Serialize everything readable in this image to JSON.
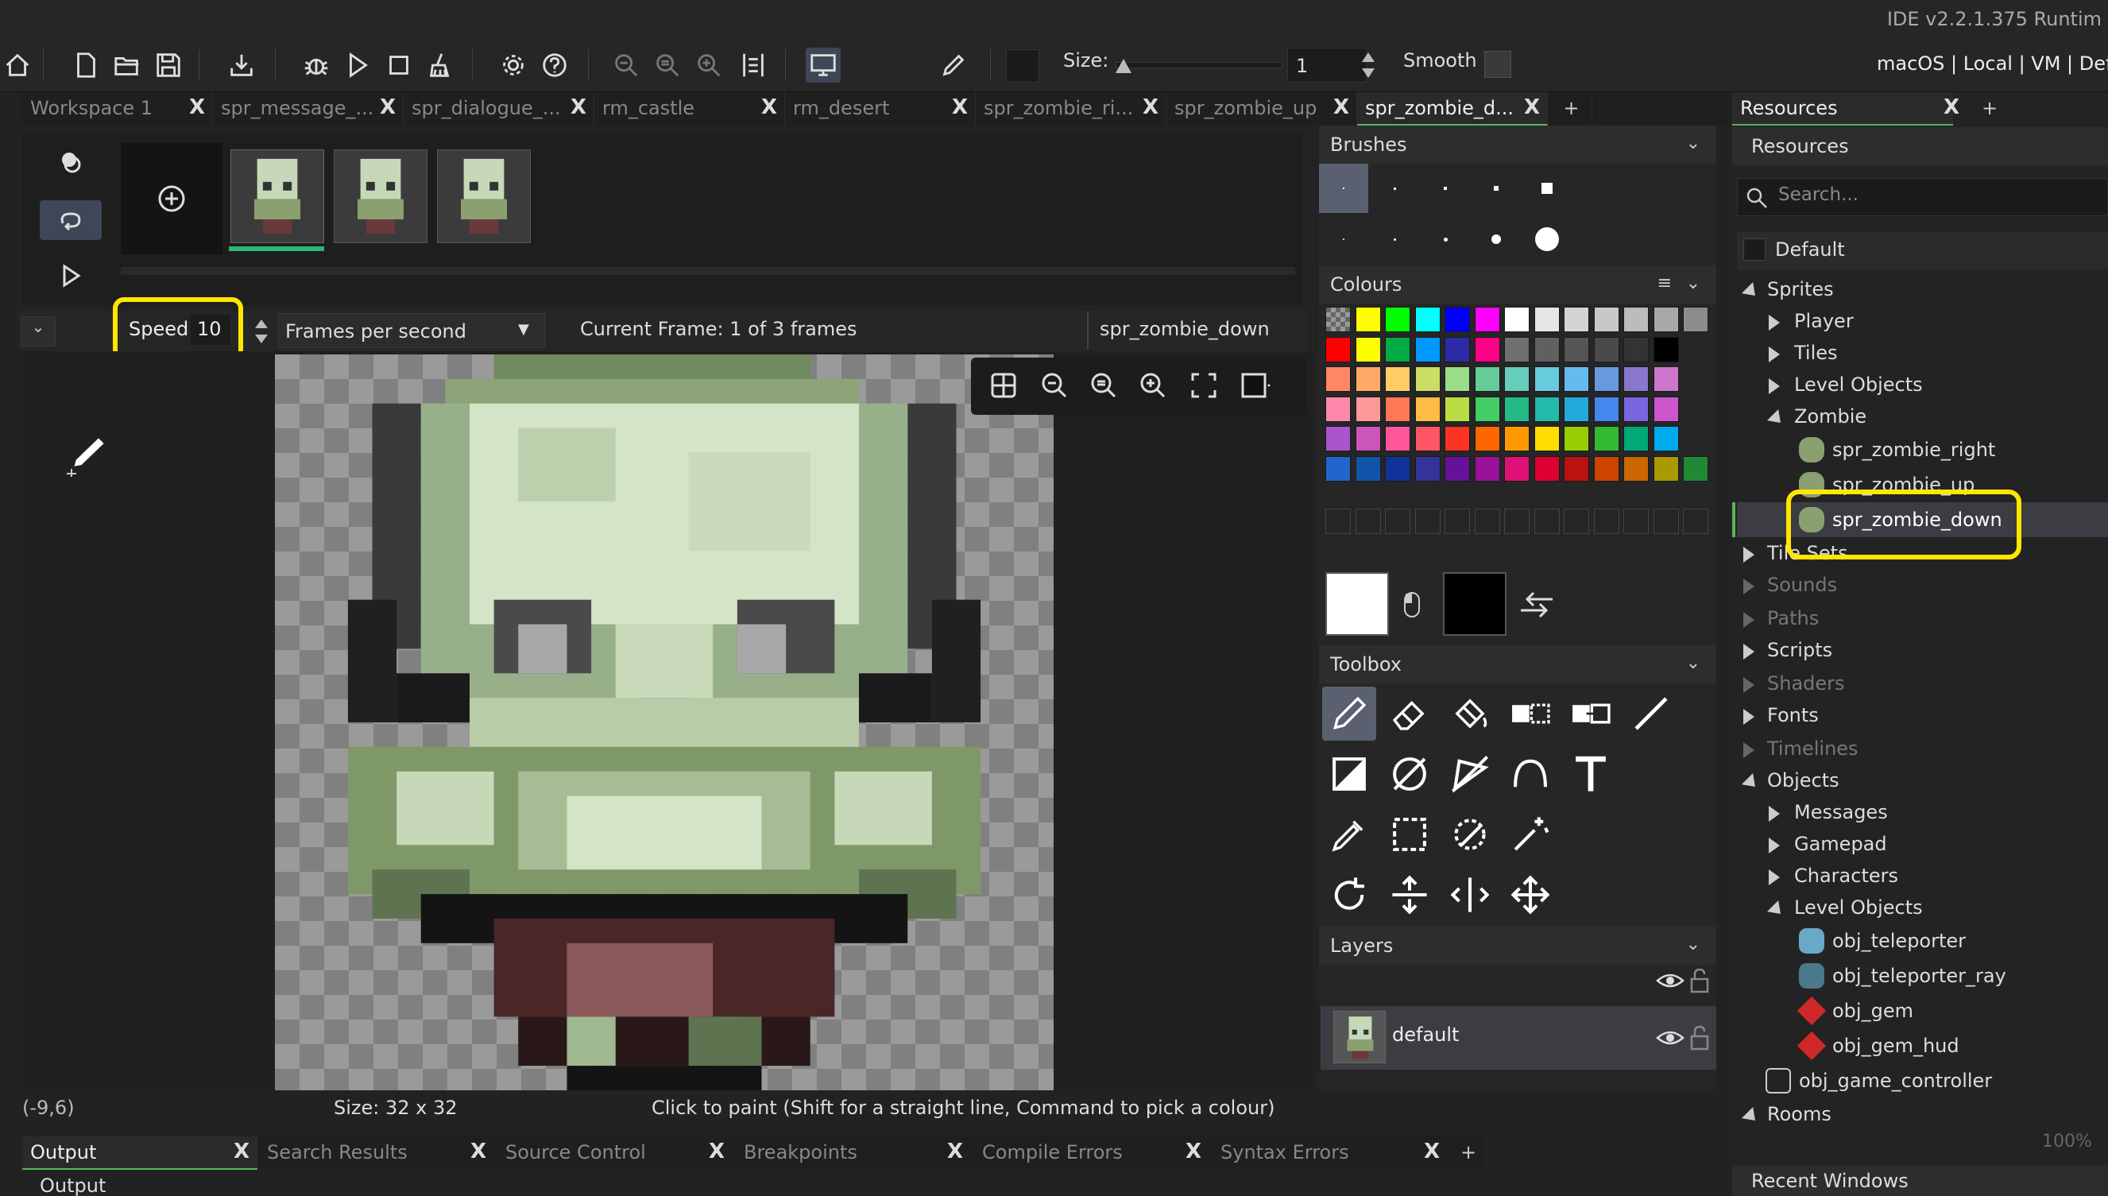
{
  "window": {
    "ide_version": "IDE v2.2.1.375  Runtim"
  },
  "toolbar": {
    "size_label": "Size:",
    "size_value": "1",
    "smooth_label": "Smooth",
    "target": "macOS | Local | VM | Defa"
  },
  "doc_tabs": [
    {
      "label": "Workspace 1"
    },
    {
      "label": "spr_message_..."
    },
    {
      "label": "spr_dialogue_..."
    },
    {
      "label": "rm_castle"
    },
    {
      "label": "rm_desert"
    },
    {
      "label": "spr_zombie_ri..."
    },
    {
      "label": "spr_zombie_up"
    },
    {
      "label": "spr_zombie_d..."
    }
  ],
  "tab_add": "+",
  "close_glyph": "X",
  "frames": {
    "count_shown": 3
  },
  "speedbar": {
    "speed_label": "Speed:",
    "speed_value": "10",
    "mode": "Frames per second",
    "current_frame": "Current Frame: 1 of 3 frames",
    "sprite_name": "spr_zombie_down"
  },
  "status": {
    "coords": "(-9,6)",
    "size": "Size: 32 x 32",
    "hint": "Click to paint (Shift for a straight line, Command to pick a colour)"
  },
  "output_tabs": [
    {
      "label": "Output"
    },
    {
      "label": "Search Results"
    },
    {
      "label": "Source Control"
    },
    {
      "label": "Breakpoints"
    },
    {
      "label": "Compile Errors"
    },
    {
      "label": "Syntax Errors"
    }
  ],
  "output_title": "Output",
  "panels": {
    "brushes": "Brushes",
    "colours": "Colours",
    "toolbox": "Toolbox",
    "layers": "Layers"
  },
  "colours": {
    "row1": [
      "#ffff00",
      "#00ff00",
      "#00ffff",
      "#0000ff",
      "#ff00ff",
      "#ffffff",
      "#e6e6e6",
      "#d4d4d4",
      "#c8c8c8",
      "#bcbcbc",
      "#a8a8a8",
      "#8c8c8c"
    ],
    "row2": [
      "#ff0000",
      "#ffff00",
      "#00aa44",
      "#0099ff",
      "#2b2baa",
      "#ff0088",
      "#707070",
      "#606060",
      "#555555",
      "#4a4a4a",
      "#333333",
      "#000000"
    ],
    "row3": [
      "#ff8866",
      "#ffaa66",
      "#ffcc66",
      "#ccdd66",
      "#99dd88",
      "#66cc99",
      "#66ccbb",
      "#66ccdd",
      "#66bbee",
      "#6699dd",
      "#8877cc",
      "#cc77cc"
    ],
    "row4": [
      "#ff88aa",
      "#ff9999",
      "#ff7755",
      "#ffbb44",
      "#bbdd44",
      "#44cc66",
      "#22bb88",
      "#22bbaa",
      "#22aadd",
      "#4488ee",
      "#7766dd",
      "#cc55cc"
    ],
    "row5": [
      "#aa55cc",
      "#cc55bb",
      "#ff5599",
      "#ff5566",
      "#ff3322",
      "#ff6600",
      "#ff9900",
      "#ffdd00",
      "#99cc00",
      "#33bb33",
      "#00aa77",
      "#00aaee"
    ],
    "row6": [
      "#2266cc",
      "#1155aa",
      "#113399",
      "#333399",
      "#661199",
      "#991199",
      "#dd1177",
      "#dd0033",
      "#bb1111",
      "#cc4400",
      "#cc6600",
      "#aa9900"
    ],
    "row6_last": "#228833"
  },
  "layers": [
    {
      "name": "default"
    }
  ],
  "resources": {
    "tab": "Resources",
    "head": "Resources",
    "search_placeholder": "Search...",
    "default": "Default",
    "tree": {
      "sprites": "Sprites",
      "player": "Player",
      "tiles": "Tiles",
      "level_objects": "Level Objects",
      "zombie": "Zombie",
      "spr_zombie_right": "spr_zombie_right",
      "spr_zombie_up": "spr_zombie_up",
      "spr_zombie_down": "spr_zombie_down",
      "tile_sets": "Tile Sets",
      "sounds": "Sounds",
      "paths": "Paths",
      "scripts": "Scripts",
      "shaders": "Shaders",
      "fonts": "Fonts",
      "timelines": "Timelines",
      "objects": "Objects",
      "messages": "Messages",
      "gamepad": "Gamepad",
      "characters": "Characters",
      "obj_level_objects": "Level Objects",
      "obj_teleporter": "obj_teleporter",
      "obj_teleporter_ray": "obj_teleporter_ray",
      "obj_gem": "obj_gem",
      "obj_gem_hud": "obj_gem_hud",
      "obj_game_controller": "obj_game_controller",
      "rooms": "Rooms"
    },
    "zoom": "100%",
    "recent": "Recent Windows"
  },
  "colors": {
    "accent_green": "#57b65a",
    "highlight_yellow": "#ffe600"
  }
}
